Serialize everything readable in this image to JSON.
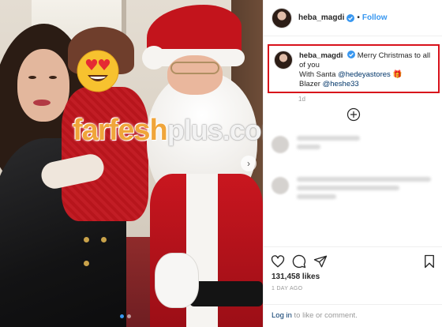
{
  "post": {
    "username": "heba_magdi",
    "verified": true,
    "follow_label": "Follow",
    "separator": "•"
  },
  "caption": {
    "username": "heba_magdi",
    "line1": "Merry Christmas to all of you",
    "line2_prefix": "With Santa",
    "mention1": "@hedeyastores",
    "emoji": "🎁",
    "line3_prefix": "Blazer",
    "mention2": "@heshe33",
    "time": "1d"
  },
  "actions": {
    "icons": [
      "heart-icon",
      "comment-icon",
      "share-icon",
      "save-icon"
    ],
    "likes": "131,458 likes",
    "date": "1 DAY AGO",
    "login_link": "Log in",
    "login_rest": "to like or comment."
  },
  "watermark": {
    "main": "farfesh",
    "suffix": "plus.com"
  },
  "colors": {
    "accent": "#3897f0",
    "highlight_border": "#d8121b",
    "watermark_orange": "#f0a53a",
    "mention": "#003569"
  }
}
